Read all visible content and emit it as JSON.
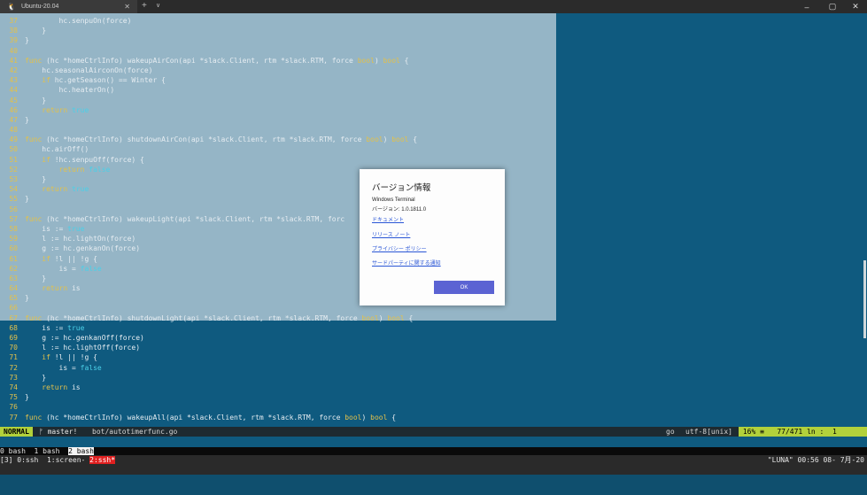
{
  "window": {
    "tab_title": "Ubuntu-20.04",
    "tab_icon": "linux-icon",
    "controls": [
      "–",
      "▢",
      "✕"
    ]
  },
  "code_lines": [
    {
      "n": "37",
      "text": "        hc.senpuOn(force)"
    },
    {
      "n": "38",
      "text": "    }"
    },
    {
      "n": "39",
      "text": "}"
    },
    {
      "n": "40",
      "text": ""
    },
    {
      "n": "41",
      "text": "func (hc *homeCtrlInfo) wakeupAirCon(api *slack.Client, rtm *slack.RTM, force bool) bool {"
    },
    {
      "n": "42",
      "text": "    hc.seasonalAirconOn(force)"
    },
    {
      "n": "43",
      "text": "    if hc.getSeason() == Winter {"
    },
    {
      "n": "44",
      "text": "        hc.heaterOn()"
    },
    {
      "n": "45",
      "text": "    }"
    },
    {
      "n": "46",
      "text": "    return true"
    },
    {
      "n": "47",
      "text": "}"
    },
    {
      "n": "48",
      "text": ""
    },
    {
      "n": "49",
      "text": "func (hc *homeCtrlInfo) shutdownAirCon(api *slack.Client, rtm *slack.RTM, force bool) bool {"
    },
    {
      "n": "50",
      "text": "    hc.airOff()"
    },
    {
      "n": "51",
      "text": "    if !hc.senpuOff(force) {"
    },
    {
      "n": "52",
      "text": "        return false"
    },
    {
      "n": "53",
      "text": "    }"
    },
    {
      "n": "54",
      "text": "    return true"
    },
    {
      "n": "55",
      "text": "}"
    },
    {
      "n": "56",
      "text": ""
    },
    {
      "n": "57",
      "text": "func (hc *homeCtrlInfo) wakeupLight(api *slack.Client, rtm *slack.RTM, forc"
    },
    {
      "n": "58",
      "text": "    is := true"
    },
    {
      "n": "59",
      "text": "    l := hc.lightOn(force)"
    },
    {
      "n": "60",
      "text": "    g := hc.genkanOn(force)"
    },
    {
      "n": "61",
      "text": "    if !l || !g {"
    },
    {
      "n": "62",
      "text": "        is = false"
    },
    {
      "n": "63",
      "text": "    }"
    },
    {
      "n": "64",
      "text": "    return is"
    },
    {
      "n": "65",
      "text": "}"
    },
    {
      "n": "66",
      "text": ""
    },
    {
      "n": "67",
      "text": "func (hc *homeCtrlInfo) shutdownLight(api *slack.Client, rtm *slack.RTM, force bool) bool {"
    },
    {
      "n": "68",
      "text": "    is := true"
    },
    {
      "n": "69",
      "text": "    g := hc.genkanOff(force)"
    },
    {
      "n": "70",
      "text": "    l := hc.lightOff(force)"
    },
    {
      "n": "71",
      "text": "    if !l || !g {"
    },
    {
      "n": "72",
      "text": "        is = false"
    },
    {
      "n": "73",
      "text": "    }"
    },
    {
      "n": "74",
      "text": "    return is"
    },
    {
      "n": "75",
      "text": "}"
    },
    {
      "n": "76",
      "text": ""
    },
    {
      "n": "77",
      "text": "func (hc *homeCtrlInfo) wakeupAll(api *slack.Client, rtm *slack.RTM, force bool) bool {"
    }
  ],
  "status": {
    "mode": "NORMAL",
    "branch": "ᚠ master!",
    "file": "bot/autotimerfunc.go",
    "filetype": "go",
    "encoding": "utf-8[unix]",
    "position": " 16% ≡   77/471 ln :  1"
  },
  "tmux": {
    "windows_line": [
      {
        "text": "0 bash",
        "active": false
      },
      {
        "text": "1 bash",
        "active": false
      },
      {
        "text": "2 bash",
        "active": true
      }
    ],
    "session_prefix": "[3] 0:ssh  1:screen- ",
    "session_active": "2:ssh*",
    "right": "\"LUNA\" 00:56 08- 7月-20"
  },
  "dialog": {
    "title": "バージョン情報",
    "app_name": "Windows Terminal",
    "version": "バージョン: 1.0.1811.0",
    "links": [
      "ドキュメント",
      "リリース ノート",
      "プライバシー ポリシー",
      "サードパーティに関する通知"
    ],
    "ok_label": "OK"
  },
  "colors": {
    "terminal_bg": "#0f5a7f",
    "selection": "#a9c2d0",
    "statusbar_accent": "#b2d13b",
    "keyword": "#e2c14b",
    "boolean": "#4bd0e8",
    "ok_button": "#5b63d3"
  }
}
